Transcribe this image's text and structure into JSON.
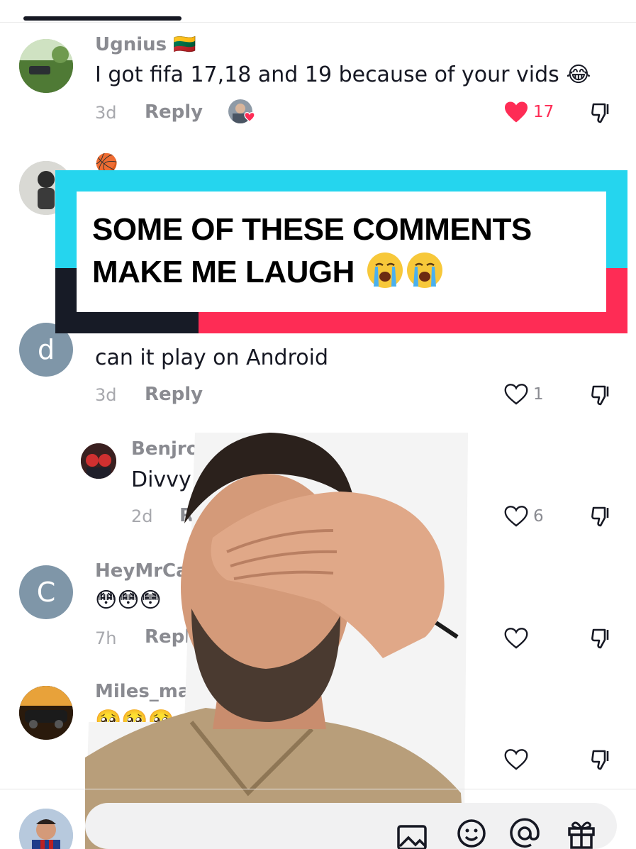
{
  "overlay": {
    "line1": "SOME OF THESE COMMENTS",
    "line2": "MAKE ME LAUGH",
    "emoji_names": [
      "loudly-crying-face",
      "loudly-crying-face"
    ]
  },
  "comments": [
    {
      "username": "Ugnius 🇱🇹",
      "text": "I got fifa 17,18 and 19 because of your vids 😂",
      "time": "3d",
      "reply_label": "Reply",
      "likes": "17",
      "liked": true
    },
    {
      "username": "🏀",
      "text": "",
      "time": "",
      "reply_label": "",
      "likes": ""
    },
    {
      "avatar_letter": "d",
      "text": "can it play on Android",
      "time": "3d",
      "reply_label": "Reply",
      "likes": "1"
    },
    {
      "username": "Benjrook",
      "text": "Divvy",
      "time": "2d",
      "reply_label": "R",
      "likes": "6"
    },
    {
      "avatar_letter": "C",
      "username": "HeyMrCa",
      "text": "😳😳😳",
      "time": "7h",
      "reply_label": "Reply",
      "likes": ""
    },
    {
      "username": "Miles_malel",
      "text": "🥺🥺🥺",
      "time": "",
      "reply_label": "",
      "likes": ""
    }
  ],
  "colors": {
    "cyan": "#25d5ee",
    "red": "#fe2c55",
    "dark": "#171b26",
    "like_red": "#fe2c55",
    "avatar_grey": "#7f96a8"
  },
  "icons": [
    "heart-outline-icon",
    "heart-filled-icon",
    "dislike-icon",
    "image-icon",
    "emoji-icon",
    "mention-icon",
    "gift-icon"
  ]
}
